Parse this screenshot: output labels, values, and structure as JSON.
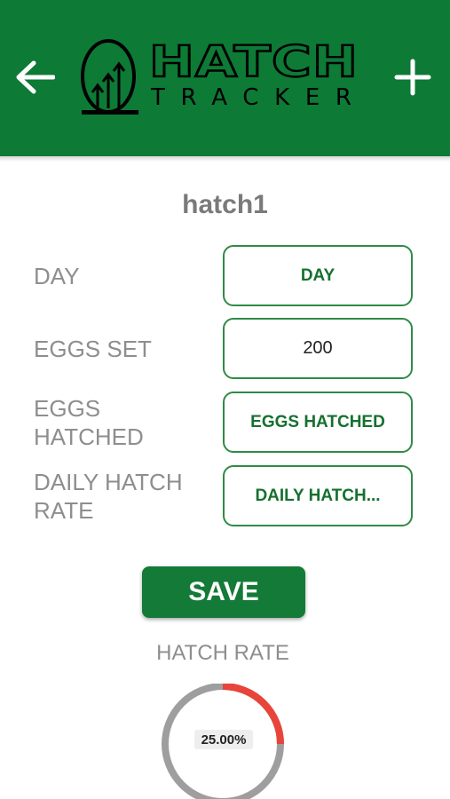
{
  "header": {
    "logo_top": "HATCH",
    "logo_bottom": "TRACKER",
    "back_icon": "arrow-left-icon",
    "add_icon": "plus-icon",
    "background_color": "#0d7a35"
  },
  "hatch": {
    "name": "hatch1"
  },
  "form": {
    "rows": [
      {
        "label": "DAY",
        "value": "DAY"
      },
      {
        "label": "EGGS SET",
        "value": "200"
      },
      {
        "label": "EGGS\nHATCHED",
        "value": "EGGS HATCHED"
      },
      {
        "label": "DAILY HATCH\nRATE",
        "value": "DAILY HATCH..."
      }
    ]
  },
  "save_label": "SAVE",
  "hatch_rate": {
    "title": "HATCH RATE",
    "value_text": "25.00%",
    "fraction": 0.25,
    "colors": {
      "filled": "#e8443a",
      "remaining": "#9e9e9e"
    }
  }
}
